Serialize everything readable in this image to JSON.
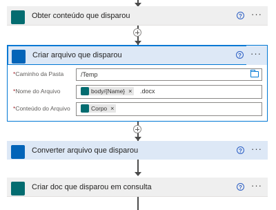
{
  "steps": [
    {
      "title": "Obter conteúdo que disparou",
      "connector": "sharepoint"
    },
    {
      "title": "Criar arquivo que disparou",
      "connector": "onedrive",
      "fields": [
        {
          "label": "Caminho da Pasta",
          "value": "/Temp"
        },
        {
          "label": "Nome do Arquivo",
          "token": "body/{Name}",
          "suffix": ".docx"
        },
        {
          "label": "Conteúdo do Arquivo",
          "token": "Corpo"
        }
      ]
    },
    {
      "title": "Converter arquivo que disparou",
      "connector": "onedrive"
    },
    {
      "title": "Criar doc que disparou em consulta",
      "connector": "sharepoint"
    }
  ],
  "help_glyph": "?",
  "more_glyph": "···",
  "required_mark": "*",
  "remove_glyph": "×",
  "colors": {
    "sharepoint": "#036c70",
    "onedrive": "#0364b8",
    "accent": "#0078d4"
  }
}
